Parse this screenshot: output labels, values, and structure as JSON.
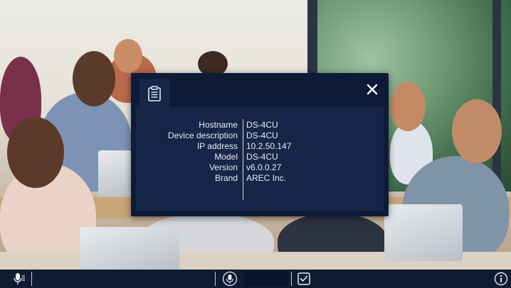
{
  "dialog": {
    "header_icon": "clipboard-icon",
    "close_icon": "close-icon",
    "info": [
      {
        "label": "Hostname",
        "value": "DS-4CU"
      },
      {
        "label": "Device description",
        "value": "DS-4CU"
      },
      {
        "label": "IP address",
        "value": "10.2.50.147"
      },
      {
        "label": "Model",
        "value": "DS-4CU"
      },
      {
        "label": "Version",
        "value": "v6.0.0.27"
      },
      {
        "label": "Brand",
        "value": "AREC Inc."
      }
    ]
  },
  "toolbar": {
    "left_icon": "microphone-settings-icon",
    "center_icon": "microphone-icon",
    "right_icon": "checklist-icon",
    "info_icon": "info-icon"
  },
  "colors": {
    "dialog_bg": "#0e1b38",
    "panel_bg": "#162648",
    "toolbar_bg": "#0d1b33",
    "text": "#e8ecf4"
  }
}
